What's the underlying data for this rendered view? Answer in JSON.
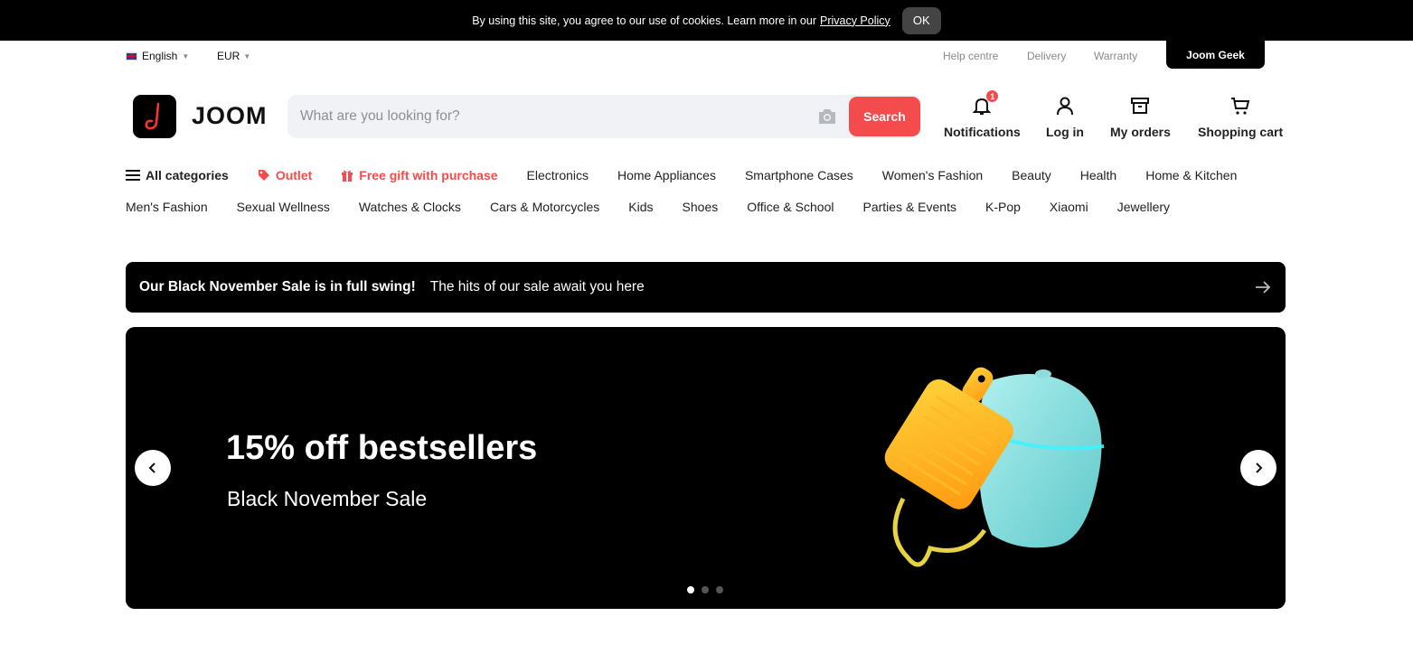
{
  "cookie": {
    "text": "By using this site, you agree to our use of cookies. Learn more in our",
    "policy_link": "Privacy Policy",
    "ok_label": "OK"
  },
  "utility": {
    "language": "English",
    "currency": "EUR",
    "links": [
      "Help centre",
      "Delivery",
      "Warranty"
    ],
    "geek_label": "Joom Geek"
  },
  "header": {
    "logo_text": "JOOM",
    "search_placeholder": "What are you looking for?",
    "search_button": "Search",
    "notifications_label": "Notifications",
    "notifications_count": "1",
    "login_label": "Log in",
    "orders_label": "My orders",
    "cart_label": "Shopping cart"
  },
  "categories": {
    "all": "All categories",
    "outlet": "Outlet",
    "gift": "Free gift with purchase",
    "row1": [
      "Electronics",
      "Home Appliances",
      "Smartphone Cases",
      "Women's Fashion",
      "Beauty",
      "Health",
      "Home & Kitchen"
    ],
    "row2": [
      "Men's Fashion",
      "Sexual Wellness",
      "Watches & Clocks",
      "Cars & Motorcycles",
      "Kids",
      "Shoes",
      "Office & School",
      "Parties & Events",
      "K-Pop",
      "Xiaomi",
      "Jewellery"
    ]
  },
  "promo": {
    "strong": "Our Black November Sale is in full swing!",
    "text": "The hits of our sale await you here"
  },
  "hero": {
    "title": "15% off bestsellers",
    "subtitle": "Black November Sale",
    "slide_count": 3,
    "active_slide": 1
  },
  "colors": {
    "accent": "#f44c4c",
    "dark": "#000000"
  }
}
